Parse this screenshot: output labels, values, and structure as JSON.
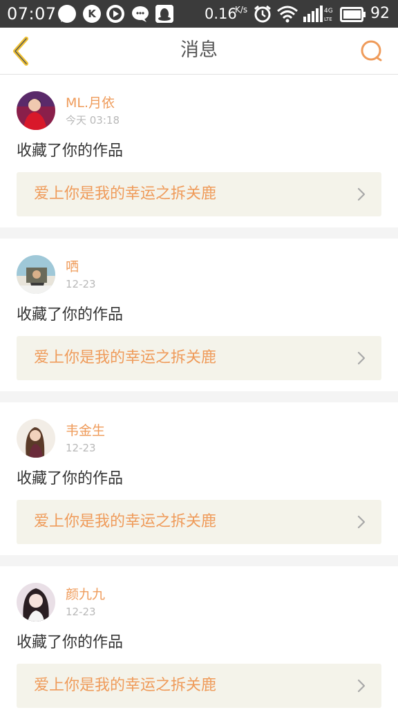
{
  "status_bar": {
    "time": "07:07",
    "app_icons": [
      "message-icon",
      "k-icon",
      "play-icon",
      "wechat-icon",
      "qq-icon"
    ],
    "k_letter": "K",
    "net_speed": "0.16",
    "net_speed_unit": "K/s",
    "network_type": "4G LTE",
    "battery": "92"
  },
  "header": {
    "title": "消息"
  },
  "colors": {
    "accent": "#ef9b5a",
    "back_arrow": "#f1c232",
    "status_bar_bg": "#3b3b3b",
    "link_bg": "#f4f3ea"
  },
  "messages": [
    {
      "username": "ML.月依",
      "time": "今天 03:18",
      "action": "收藏了你的作品",
      "work_title": "爱上你是我的幸运之拆关鹿",
      "avatar": "avatar-red-dress"
    },
    {
      "username": "哂",
      "time": "12-23",
      "action": "收藏了你的作品",
      "work_title": "爱上你是我的幸运之拆关鹿",
      "avatar": "avatar-car-window"
    },
    {
      "username": "韦金生",
      "time": "12-23",
      "action": "收藏了你的作品",
      "work_title": "爱上你是我的幸运之拆关鹿",
      "avatar": "avatar-long-hair"
    },
    {
      "username": "颜九九",
      "time": "12-23",
      "action": "收藏了你的作品",
      "work_title": "爱上你是我的幸运之拆关鹿",
      "avatar": "avatar-portrait"
    }
  ]
}
